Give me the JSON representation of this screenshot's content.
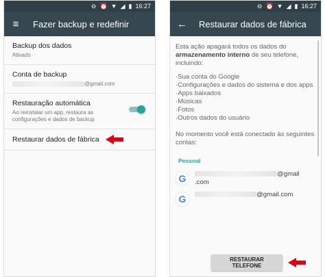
{
  "status": {
    "time": "16:27"
  },
  "left": {
    "title": "Fazer backup e redefinir",
    "items": [
      {
        "title": "Backup dos dados",
        "subtitle": "Ativado"
      },
      {
        "title": "Conta de backup",
        "email_suffix": "@gmail.com"
      },
      {
        "title": "Restauração automática",
        "subtitle": "Ao reinstalar um app, restaura as configurações e dados de backup",
        "toggle": "on"
      },
      {
        "title": "Restaurar dados de fábrica"
      }
    ]
  },
  "right": {
    "title": "Restaurar dados de fábrica",
    "intro_before": "Esta ação apagará todos os dados do ",
    "intro_bold": "armazenamento interno",
    "intro_after": " de seu telefone, incluindo:",
    "bullets": [
      "·Sua conta do Google",
      "·Configurações e dados do sistema e dos apps",
      "·Apps baixados",
      "·Músicas",
      "·Fotos",
      "·Outros dados do usuário"
    ],
    "connected_text": "No momento você está conectado às seguintes contas:",
    "section_label": "Pessoal",
    "accounts": [
      {
        "line1_suffix": "@gmail",
        "line2": ".com"
      },
      {
        "line1_suffix": "@gmail.com"
      }
    ],
    "button_label": "RESTAURAR TELEFONE"
  },
  "colors": {
    "accent": "#26a69a",
    "appbar": "#37474f",
    "arrow": "#e3000f"
  }
}
